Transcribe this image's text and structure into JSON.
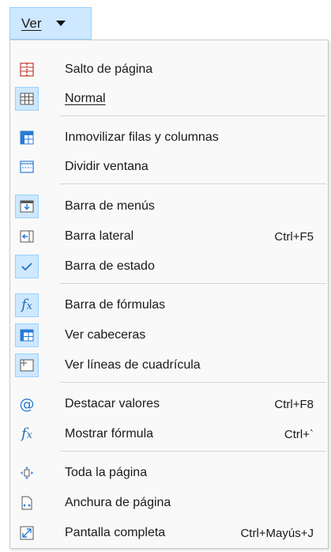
{
  "menu_button": {
    "label": "Ver"
  },
  "items": [
    {
      "label": "Salto de página",
      "icon": "page-break-icon",
      "shortcut": ""
    },
    {
      "label": "Normal",
      "icon": "normal-view-icon",
      "shortcut": ""
    },
    {
      "label": "Inmovilizar filas y columnas",
      "icon": "freeze-rows-columns-icon",
      "shortcut": ""
    },
    {
      "label": "Dividir ventana",
      "icon": "split-window-icon",
      "shortcut": ""
    },
    {
      "label": "Barra de menús",
      "icon": "menubar-icon",
      "shortcut": ""
    },
    {
      "label": "Barra lateral",
      "icon": "sidebar-icon",
      "shortcut": "Ctrl+F5"
    },
    {
      "label": "Barra de estado",
      "icon": "checkmark-icon",
      "shortcut": ""
    },
    {
      "label": "Barra de fórmulas",
      "icon": "formula-bar-icon",
      "shortcut": ""
    },
    {
      "label": "Ver cabeceras",
      "icon": "headers-icon",
      "shortcut": ""
    },
    {
      "label": "Ver líneas de cuadrícula",
      "icon": "grid-lines-icon",
      "shortcut": ""
    },
    {
      "label": "Destacar valores",
      "icon": "value-highlighting-icon",
      "shortcut": "Ctrl+F8"
    },
    {
      "label": "Mostrar fórmula",
      "icon": "show-formula-icon",
      "shortcut": "Ctrl+`"
    },
    {
      "label": "Toda la página",
      "icon": "whole-page-icon",
      "shortcut": ""
    },
    {
      "label": "Anchura de página",
      "icon": "page-width-icon",
      "shortcut": ""
    },
    {
      "label": "Pantalla completa",
      "icon": "full-screen-icon",
      "shortcut": "Ctrl+Mayús+J"
    }
  ],
  "checked_items": [
    "Normal",
    "Barra de menús",
    "Barra de estado",
    "Barra de fórmulas",
    "Ver cabeceras",
    "Ver líneas de cuadrícula"
  ],
  "colors": {
    "accent": "#2a7ad5",
    "checked_bg": "#cde8ff",
    "checked_border": "#99d1ff",
    "menu_bg": "#f9f9f9"
  }
}
